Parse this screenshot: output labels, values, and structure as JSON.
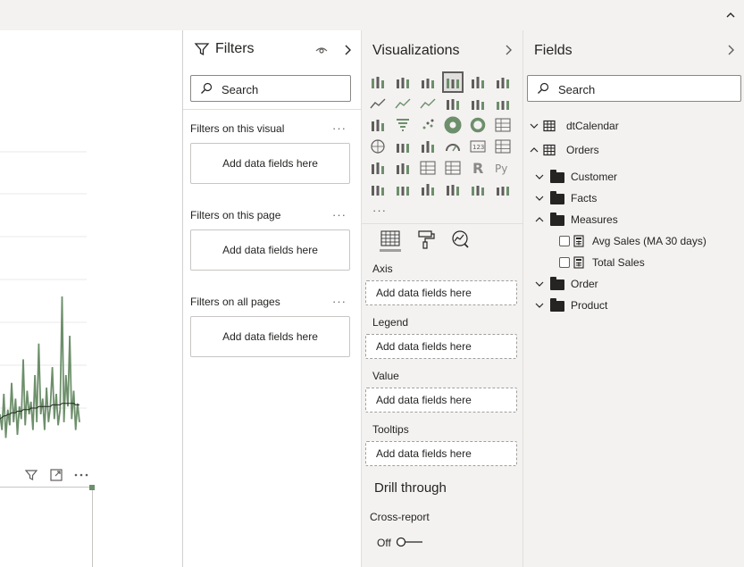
{
  "window": {
    "collapse_ribbon_icon": "chevron-up-icon"
  },
  "chart_data": {
    "type": "line",
    "title": "",
    "xlabel": "",
    "ylabel": "",
    "series": [
      {
        "color": "#6d8f6b",
        "values": [
          0.25,
          0.15,
          0.38,
          0.1,
          0.28,
          0.18,
          0.45,
          0.2,
          0.35,
          0.12,
          0.3,
          0.22,
          0.6,
          0.18,
          0.4,
          0.25,
          0.33,
          0.15,
          0.5,
          0.2,
          0.7,
          0.25,
          0.35,
          0.15,
          0.42,
          0.2,
          0.3,
          0.55,
          0.22,
          0.38,
          0.18,
          0.28,
          1.0,
          0.2,
          0.5,
          0.3,
          0.75,
          0.22,
          0.4,
          0.15,
          0.32,
          0.2
        ]
      },
      {
        "color": "#252423",
        "values": [
          0.22,
          0.23,
          0.24,
          0.24,
          0.25,
          0.25,
          0.26,
          0.26,
          0.26,
          0.27,
          0.27,
          0.27,
          0.28,
          0.28,
          0.28,
          0.28,
          0.29,
          0.29,
          0.29,
          0.29,
          0.3,
          0.3,
          0.3,
          0.3,
          0.3,
          0.3,
          0.3,
          0.31,
          0.31,
          0.31,
          0.31,
          0.31,
          0.32,
          0.32,
          0.32,
          0.32,
          0.32,
          0.32,
          0.32,
          0.31,
          0.31,
          0.31
        ]
      }
    ]
  },
  "visual_header": {
    "icons": [
      "filter-icon",
      "focus-mode-icon",
      "more-options-icon"
    ]
  },
  "filters": {
    "title": "Filters",
    "search_placeholder": "Search",
    "sections": [
      {
        "label": "Filters on this visual",
        "well": "Add data fields here",
        "more": "···"
      },
      {
        "label": "Filters on this page",
        "well": "Add data fields here",
        "more": "···"
      },
      {
        "label": "Filters on all pages",
        "well": "Add data fields here",
        "more": "···"
      }
    ]
  },
  "visualizations": {
    "title": "Visualizations",
    "more": "···",
    "tabs": [
      "fields-tab-icon",
      "format-tab-icon",
      "analytics-tab-icon"
    ],
    "wells": [
      {
        "label": "Axis",
        "well": "Add data fields here"
      },
      {
        "label": "Legend",
        "well": "Add data fields here"
      },
      {
        "label": "Value",
        "well": "Add data fields here"
      },
      {
        "label": "Tooltips",
        "well": "Add data fields here"
      }
    ],
    "drill_through": "Drill through",
    "cross_report": "Cross-report",
    "toggle_label": "Off"
  },
  "fields": {
    "title": "Fields",
    "search_placeholder": "Search",
    "tables": [
      {
        "name": "dtCalendar",
        "expanded": false
      },
      {
        "name": "Orders",
        "expanded": true
      }
    ],
    "folders": [
      {
        "name": "Customer",
        "expanded": false
      },
      {
        "name": "Facts",
        "expanded": false
      },
      {
        "name": "Measures",
        "expanded": true
      },
      {
        "name": "Order",
        "expanded": false
      },
      {
        "name": "Product",
        "expanded": false
      }
    ],
    "measures": [
      "Avg Sales (MA 30 days)",
      "Total Sales"
    ]
  }
}
